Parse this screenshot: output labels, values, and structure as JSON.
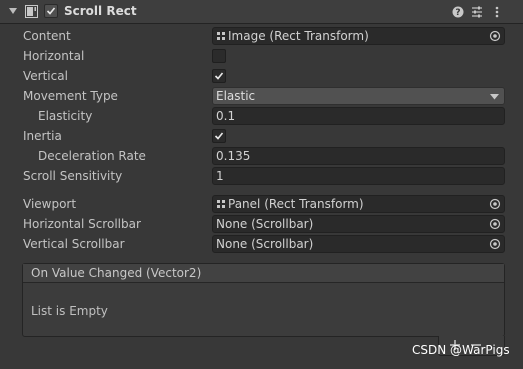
{
  "component": {
    "title": "Scroll Rect",
    "enabled": true,
    "icons": [
      "foldout-arrow-icon",
      "scroll-rect-component-icon",
      "help-icon",
      "presets-icon",
      "kebab-menu-icon"
    ]
  },
  "properties": {
    "content": {
      "label": "Content",
      "value": "Image (Rect Transform)"
    },
    "horizontal": {
      "label": "Horizontal",
      "checked": false
    },
    "vertical": {
      "label": "Vertical",
      "checked": true
    },
    "movement_type": {
      "label": "Movement Type",
      "value": "Elastic"
    },
    "elasticity": {
      "label": "Elasticity",
      "value": "0.1"
    },
    "inertia": {
      "label": "Inertia",
      "checked": true
    },
    "deceleration_rate": {
      "label": "Deceleration Rate",
      "value": "0.135"
    },
    "scroll_sensitivity": {
      "label": "Scroll Sensitivity",
      "value": "1"
    },
    "viewport": {
      "label": "Viewport",
      "value": "Panel (Rect Transform)"
    },
    "horizontal_scrollbar": {
      "label": "Horizontal Scrollbar",
      "value": "None (Scrollbar)"
    },
    "vertical_scrollbar": {
      "label": "Vertical Scrollbar",
      "value": "None (Scrollbar)"
    }
  },
  "event": {
    "title": "On Value Changed (Vector2)",
    "empty_text": "List is Empty"
  },
  "watermark": "CSDN @WarPigs",
  "colors": {
    "background": "#383838",
    "field": "#2a2a2a",
    "dropdown": "#515151",
    "text": "#c4c4c4"
  }
}
